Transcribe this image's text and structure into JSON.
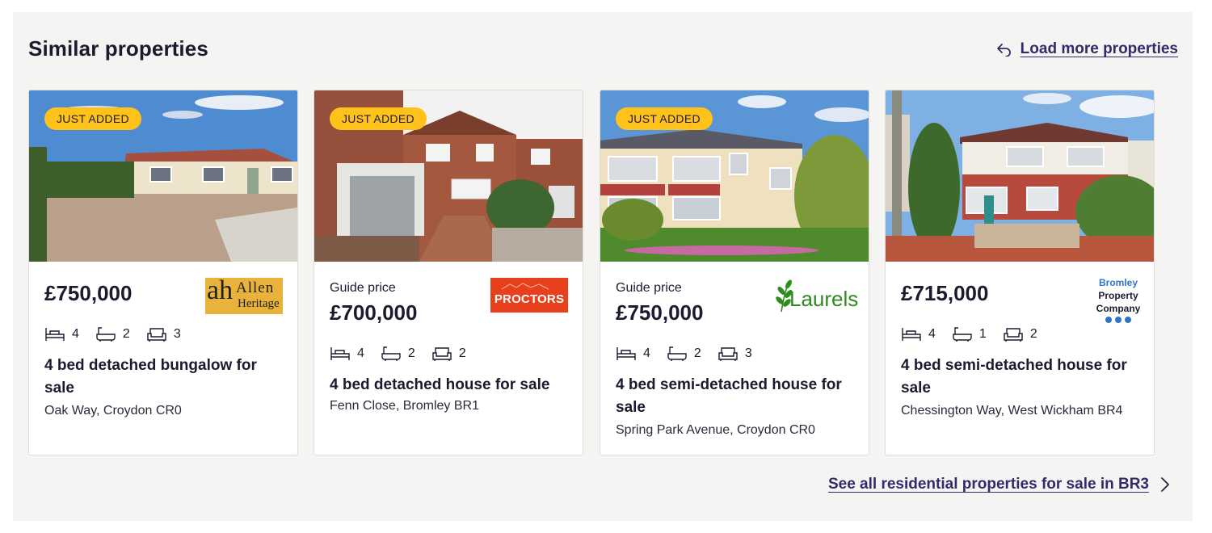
{
  "section": {
    "title": "Similar properties",
    "load_more": "Load more properties",
    "see_all": "See all residential properties for sale in BR3"
  },
  "cards": [
    {
      "badge": "JUST ADDED",
      "guide": "",
      "price": "£750,000",
      "agent": {
        "line1": "Allen",
        "line2": "Heritage",
        "mono": "ah"
      },
      "beds": "4",
      "baths": "2",
      "receptions": "3",
      "title": "4 bed detached bungalow for sale",
      "address": "Oak Way, Croydon CR0"
    },
    {
      "badge": "JUST ADDED",
      "guide": "Guide price",
      "price": "£700,000",
      "agent": {
        "name": "PROCTORS"
      },
      "beds": "4",
      "baths": "2",
      "receptions": "2",
      "title": "4 bed detached house for sale",
      "address": "Fenn Close, Bromley BR1"
    },
    {
      "badge": "JUST ADDED",
      "guide": "Guide price",
      "price": "£750,000",
      "agent": {
        "name": "Laurels"
      },
      "beds": "4",
      "baths": "2",
      "receptions": "3",
      "title": "4 bed semi-detached house for sale",
      "address": "Spring Park Avenue, Croydon CR0"
    },
    {
      "badge": "",
      "guide": "",
      "price": "£715,000",
      "agent": {
        "line1": "Bromley",
        "line2": "Property",
        "line3": "Company"
      },
      "beds": "4",
      "baths": "1",
      "receptions": "2",
      "title": "4 bed semi-detached house for sale",
      "address": "Chessington Way, West Wickham BR4"
    }
  ],
  "colors": {
    "accent_link": "#322a6b",
    "badge": "#ffc21a",
    "panel_bg": "#f5f4f2",
    "proctors": "#e8401c",
    "laurels": "#2e8b1e",
    "bromley_blue": "#2f74c8"
  }
}
